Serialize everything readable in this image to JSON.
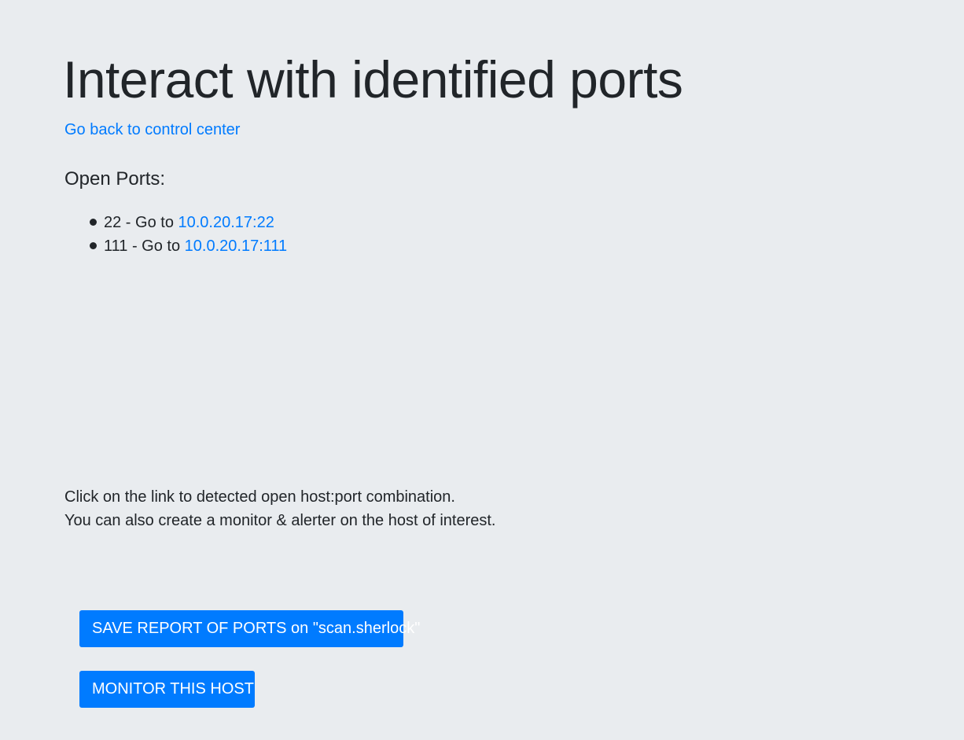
{
  "header": {
    "title": "Interact with identified ports",
    "back_link": "Go back to control center"
  },
  "open_ports": {
    "heading": "Open Ports:",
    "items": [
      {
        "port": "22",
        "prefix": "22 - Go to ",
        "link": "10.0.20.17:22"
      },
      {
        "port": "111",
        "prefix": "111 - Go to ",
        "link": "10.0.20.17:111"
      }
    ]
  },
  "info": {
    "line1": "Click on the link to detected open host:port combination.",
    "line2": "You can also create a monitor & alerter on the host of interest."
  },
  "actions": {
    "save_label": "SAVE REPORT OF PORTS on \"scan.sherlock\"",
    "monitor_label": "MONITOR THIS HOST"
  },
  "colors": {
    "background": "#e9ecef",
    "text": "#212529",
    "link": "#007bff",
    "button_bg": "#007bff",
    "button_text": "#ffffff"
  }
}
